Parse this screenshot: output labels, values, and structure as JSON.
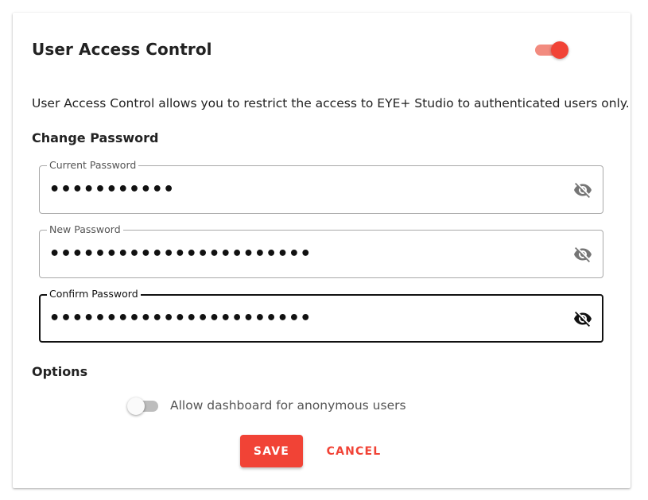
{
  "card": {
    "title": "User Access Control",
    "access_control_enabled": true,
    "description": "User Access Control allows you to restrict the access to EYE+ Studio to authenticated users only."
  },
  "change_password": {
    "heading": "Change Password",
    "fields": [
      {
        "label": "Current Password",
        "value": "•••••••••••",
        "icon": "eye-off-icon",
        "focused": false
      },
      {
        "label": "New Password",
        "value": "•••••••••••••••••••••••",
        "icon": "eye-off-icon",
        "focused": false
      },
      {
        "label": "Confirm Password",
        "value": "•••••••••••••••••••••••",
        "icon": "eye-off-icon",
        "focused": true
      }
    ]
  },
  "options": {
    "heading": "Options",
    "anonymous_dashboard_label": "Allow dashboard for anonymous users",
    "anonymous_dashboard_enabled": false
  },
  "actions": {
    "save_label": "SAVE",
    "cancel_label": "CANCEL"
  },
  "colors": {
    "accent": "#f14336",
    "accent_light": "#f28b7f",
    "text": "#222222",
    "muted_text": "#555555"
  }
}
